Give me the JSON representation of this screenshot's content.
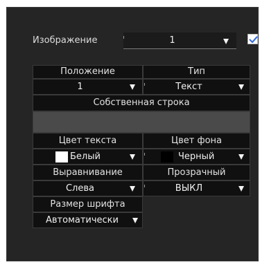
{
  "image_row": {
    "label": "Изображение",
    "select_value": "1",
    "checkbox_checked": true
  },
  "grid": {
    "position_header": "Положение",
    "type_header": "Тип",
    "position_value": "1",
    "type_value": "Текст",
    "own_string_header": "Собственная строка",
    "own_string_value": "",
    "text_color_header": "Цвет текста",
    "bg_color_header": "Цвет фона",
    "text_color_value": "Белый",
    "bg_color_value": "Черный",
    "text_color_swatch": "#ffffff",
    "bg_color_swatch": "#000000",
    "align_header": "Выравнивание",
    "transparent_header": "Прозрачный",
    "align_value": "Слева",
    "transparent_value": "ВЫКЛ",
    "font_size_header": "Размер шрифта",
    "font_size_value": "Автоматически"
  },
  "colors": {
    "panel_bg": "#252525",
    "cell_bg": "#101010",
    "input_bg": "#4a4a4a",
    "checkbox_mark": "#3b6fd6"
  }
}
